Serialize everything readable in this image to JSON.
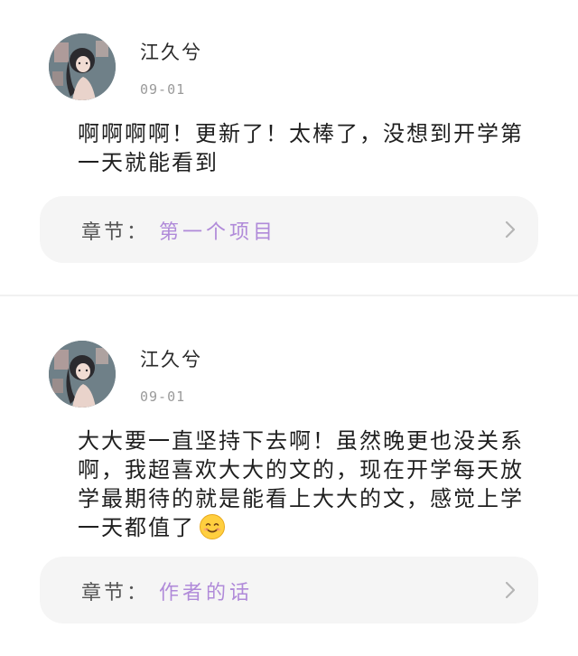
{
  "comments": [
    {
      "username": "江久兮",
      "date": "09-01",
      "text": "啊啊啊啊！更新了！太棒了，没想到开学第一天就能看到",
      "chapter_label": "章节：",
      "chapter_title": "第一个项目"
    },
    {
      "username": "江久兮",
      "date": "09-01",
      "text": "大大要一直坚持下去啊！虽然晚更也没关系啊，我超喜欢大大的文的，现在开学每天放学最期待的就是能看上大大的文，感觉上学一天都值了",
      "emoji": "smiling-face-emoji",
      "chapter_label": "章节：",
      "chapter_title": "作者的话"
    }
  ],
  "colors": {
    "accent": "#b08ad9",
    "card_bg": "#f5f5f5",
    "date": "#9a9a9a"
  },
  "icons": {
    "chevron": "chevron-right-icon",
    "avatar": "avatar"
  }
}
